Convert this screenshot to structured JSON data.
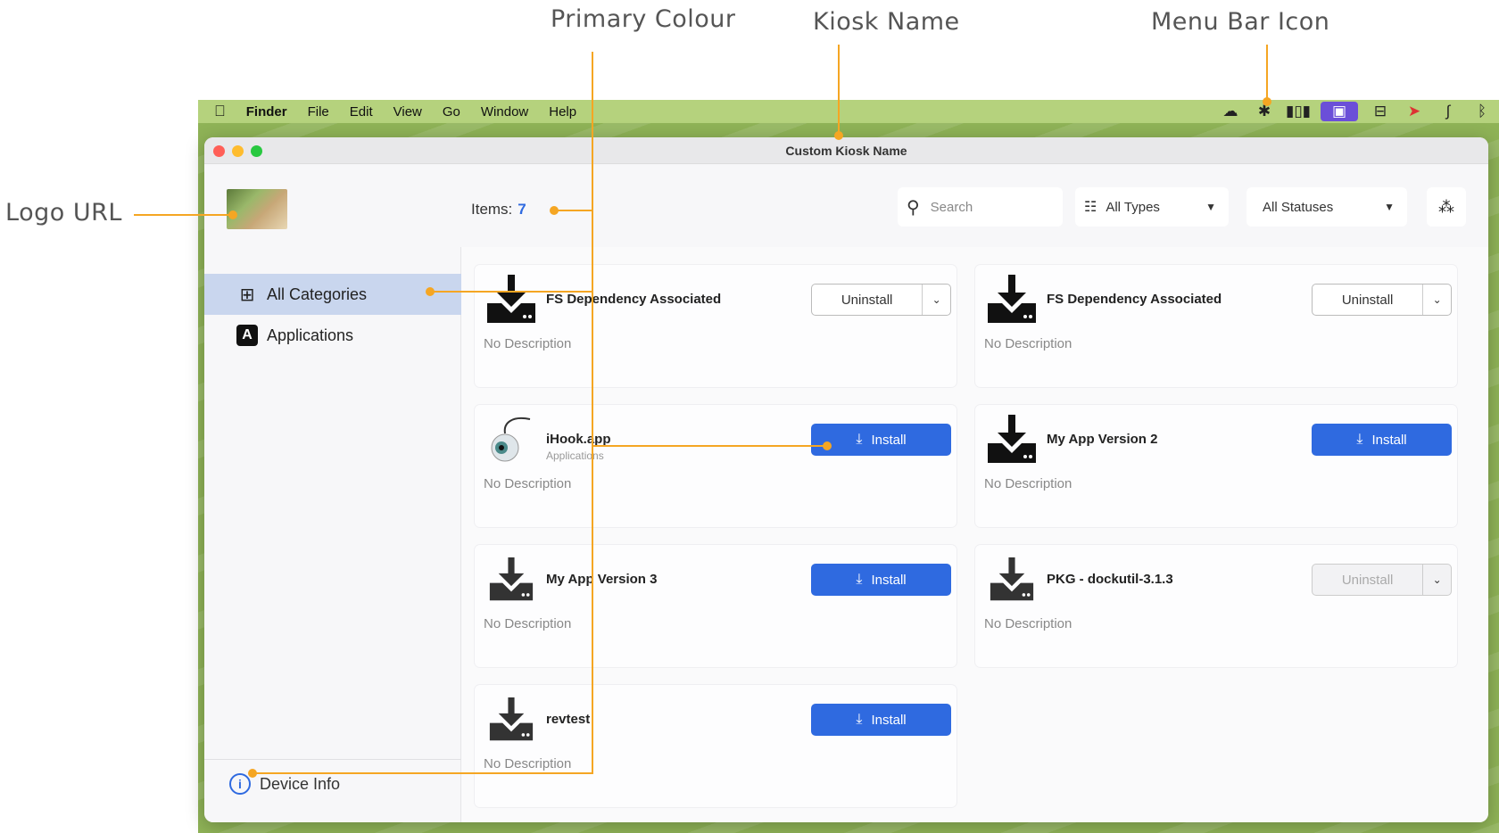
{
  "annotations": {
    "primary_colour": "Primary Colour",
    "kiosk_name": "Kiosk Name",
    "menu_bar_icon": "Menu Bar Icon",
    "logo_url": "Logo URL"
  },
  "menubar": {
    "app": "Finder",
    "items": [
      "File",
      "Edit",
      "View",
      "Go",
      "Window",
      "Help"
    ]
  },
  "window": {
    "title": "Custom Kiosk Name"
  },
  "toolbar": {
    "items_label": "Items:",
    "items_count": "7",
    "search_placeholder": "Search",
    "type_filter": "All Types",
    "status_filter": "All Statuses"
  },
  "sidebar": {
    "items": [
      {
        "label": "All Categories",
        "icon": "grid-icon"
      },
      {
        "label": "Applications",
        "icon": "app-store-icon"
      }
    ],
    "device_info": "Device Info"
  },
  "cards": [
    {
      "name": "FS Dependency Associated",
      "subtitle": "",
      "description": "No Description",
      "action": "Uninstall",
      "state": "installed"
    },
    {
      "name": "FS Dependency Associated",
      "subtitle": "",
      "description": "No Description",
      "action": "Uninstall",
      "state": "installed"
    },
    {
      "name": "iHook.app",
      "subtitle": "Applications",
      "description": "No Description",
      "action": "Install",
      "state": "available"
    },
    {
      "name": "My App Version 2",
      "subtitle": "",
      "description": "No Description",
      "action": "Install",
      "state": "available"
    },
    {
      "name": "My App Version 3",
      "subtitle": "",
      "description": "No Description",
      "action": "Install",
      "state": "available"
    },
    {
      "name": "PKG - dockutil-3.1.3",
      "subtitle": "",
      "description": "No Description",
      "action": "Uninstall",
      "state": "disabled"
    },
    {
      "name": "revtest",
      "subtitle": "",
      "description": "No Description",
      "action": "Install",
      "state": "available"
    }
  ],
  "colors": {
    "primary": "#2f6ae0",
    "callout": "#f5a623",
    "selected_sidebar": "#c9d6ee"
  }
}
